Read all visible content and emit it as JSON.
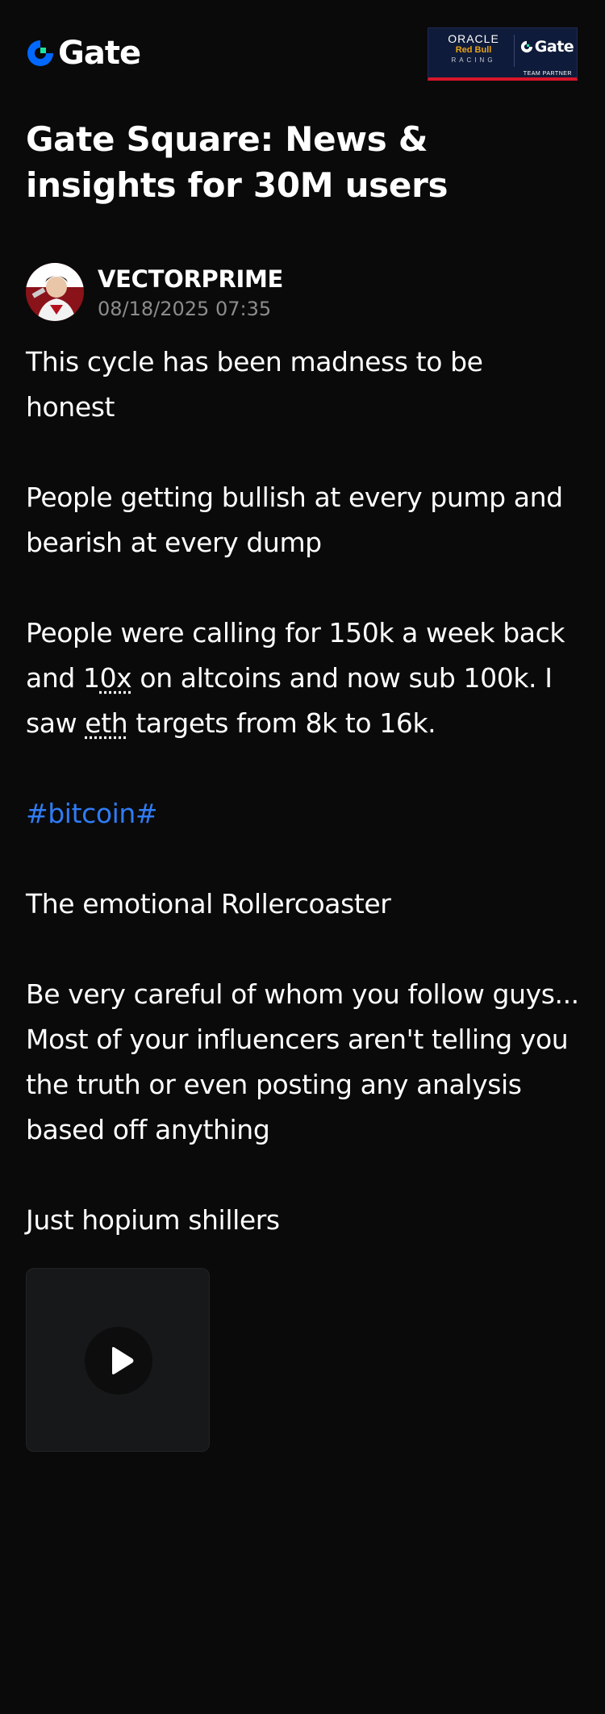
{
  "header": {
    "logo_text": "Gate",
    "logo_icon": "gate-logo-icon",
    "partner_badge": {
      "oracle": "ORACLE",
      "redbull": "Red Bull",
      "racing": "RACING",
      "gate": "Gate",
      "caption": "TEAM PARTNER"
    }
  },
  "page_title": "Gate Square: News & insights for 30M users",
  "post": {
    "author": {
      "name": "VECTORPRIME",
      "timestamp": "08/18/2025 07:35"
    },
    "paragraphs": [
      "This cycle has been madness to be honest",
      "People getting bullish at every pump and bearish at every dump"
    ],
    "p3": {
      "line1": "People were calling for 150k a week back",
      "line2_pre": "and 1",
      "line2_link": "0x",
      "line2_post": " on altcoins and now sub 100k. I",
      "line3_pre": "saw ",
      "line3_link": "eth",
      "line3_post": " targets from 8k to 16k."
    },
    "hashtag": "#bitcoin#",
    "p5": "The emotional Rollercoaster",
    "p6": {
      "line1": "Be very careful of whom you follow guys...",
      "line2": "Most of your influencers aren't telling you",
      "line3": "the truth or even posting any analysis",
      "line4": "based off anything"
    },
    "p7": "Just hopium shillers",
    "media": {
      "type": "video",
      "icon": "play-icon"
    }
  },
  "colors": {
    "background": "#0a0a0a",
    "text": "#ffffff",
    "muted": "#8c8c8c",
    "hashtag": "#2f7cf6",
    "brand_blue": "#0068ff",
    "brand_green": "#17e6a1",
    "badge_navy": "#0f1b3a",
    "badge_red": "#d8152b"
  }
}
